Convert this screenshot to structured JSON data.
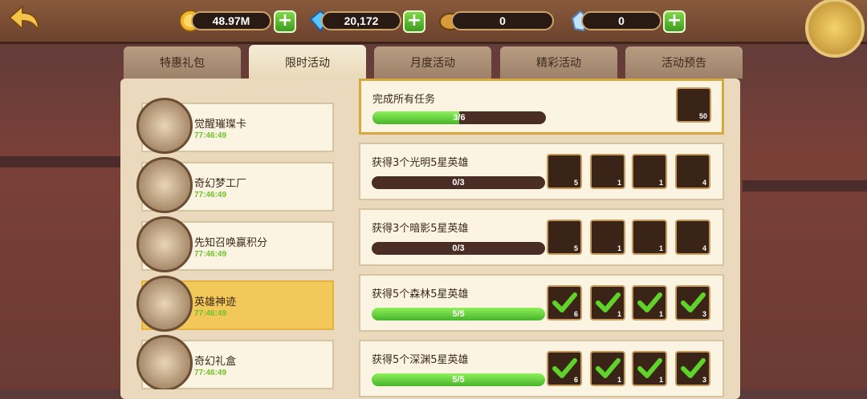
{
  "resources": [
    {
      "icon": "gold-coin-icon",
      "value": "48.97M"
    },
    {
      "icon": "diamond-icon",
      "value": "20,172"
    },
    {
      "icon": "hero-token-icon",
      "value": "0"
    },
    {
      "icon": "crystal-icon",
      "value": "0"
    }
  ],
  "tabs": [
    {
      "label": "特惠礼包"
    },
    {
      "label": "限时活动"
    },
    {
      "label": "月度活动"
    },
    {
      "label": "精彩活动"
    },
    {
      "label": "活动预告"
    }
  ],
  "events": [
    {
      "title": "觉醒璀璨卡",
      "time": "77:46:49",
      "icon": "card-icon"
    },
    {
      "title": "奇幻梦工厂",
      "time": "77:46:49",
      "icon": "candy-icon"
    },
    {
      "title": "先知召唤赢积分",
      "time": "77:46:49",
      "icon": "purple-flame-icon"
    },
    {
      "title": "英雄神迹",
      "time": "77:46:49",
      "icon": "golden-hero-icon"
    },
    {
      "title": "奇幻礼盒",
      "time": "77:46:49",
      "icon": "gift-box-icon"
    }
  ],
  "tasks": [
    {
      "title": "完成所有任务",
      "progress": "3/6",
      "fraction": 0.5,
      "rewards": [
        {
          "count": "50"
        }
      ]
    },
    {
      "title": "获得3个光明5星英雄",
      "progress": "0/3",
      "fraction": 0,
      "rewards": [
        {
          "count": "5"
        },
        {
          "count": "1"
        },
        {
          "count": "1"
        },
        {
          "count": "4"
        }
      ]
    },
    {
      "title": "获得3个暗影5星英雄",
      "progress": "0/3",
      "fraction": 0,
      "rewards": [
        {
          "count": "5"
        },
        {
          "count": "1"
        },
        {
          "count": "1"
        },
        {
          "count": "4"
        }
      ]
    },
    {
      "title": "获得5个森林5星英雄",
      "progress": "5/5",
      "fraction": 1,
      "rewards": [
        {
          "count": "6"
        },
        {
          "count": "1"
        },
        {
          "count": "1"
        },
        {
          "count": "3"
        }
      ]
    },
    {
      "title": "获得5个深渊5星英雄",
      "progress": "5/5",
      "fraction": 1,
      "rewards": [
        {
          "count": "6"
        },
        {
          "count": "1"
        },
        {
          "count": "1"
        },
        {
          "count": "3"
        }
      ]
    }
  ]
}
